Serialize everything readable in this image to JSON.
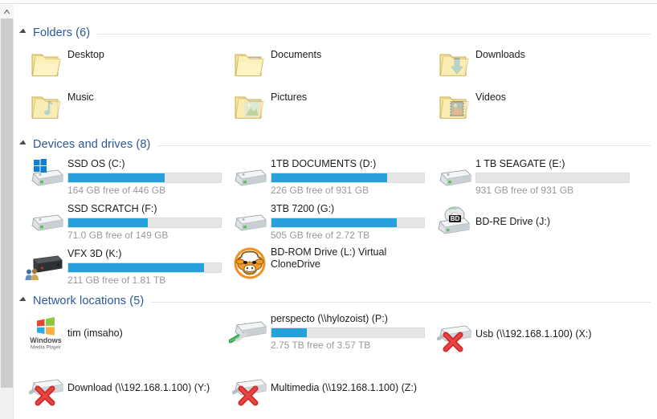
{
  "window": {
    "scrollbar": {
      "up_arrow": "scroll-up-arrow"
    }
  },
  "colors": {
    "group_header": "#2b5797",
    "bar_fill_blue": "#26a0da",
    "bar_track": "#e6e6e6",
    "label_text": "#1c1c1c",
    "sub_text": "#999999"
  },
  "groups": [
    {
      "id": "folders",
      "title": "Folders (6)",
      "expanded": true,
      "items": [
        {
          "name": "Desktop",
          "icon": "folder-desktop-icon"
        },
        {
          "name": "Documents",
          "icon": "folder-documents-icon"
        },
        {
          "name": "Downloads",
          "icon": "folder-downloads-icon"
        },
        {
          "name": "Music",
          "icon": "folder-music-icon"
        },
        {
          "name": "Pictures",
          "icon": "folder-pictures-icon"
        },
        {
          "name": "Videos",
          "icon": "folder-videos-icon"
        }
      ]
    },
    {
      "id": "devices",
      "title": "Devices and drives (8)",
      "expanded": true,
      "items": [
        {
          "name": "SSD OS (C:)",
          "icon": "hard-drive-windows-icon",
          "capacity": "164 GB free of 446 GB",
          "used_percent": 63,
          "bar": true
        },
        {
          "name": "1TB DOCUMENTS (D:)",
          "icon": "hard-drive-icon",
          "capacity": "226 GB free of 931 GB",
          "used_percent": 76,
          "bar": true
        },
        {
          "name": "1 TB SEAGATE (E:)",
          "icon": "hard-drive-icon",
          "capacity": "931 GB free of 931 GB",
          "used_percent": 0,
          "bar": true
        },
        {
          "name": "SSD SCRATCH (F:)",
          "icon": "hard-drive-icon",
          "capacity": "71.0 GB free of 149 GB",
          "used_percent": 52,
          "bar": true
        },
        {
          "name": "3TB 7200 (G:)",
          "icon": "hard-drive-icon",
          "capacity": "505 GB free of 2.72 TB",
          "used_percent": 82,
          "bar": true
        },
        {
          "name": "BD-RE Drive (J:)",
          "icon": "bd-re-drive-icon",
          "capacity": "",
          "used_percent": 0,
          "bar": false
        },
        {
          "name": "VFX 3D (K:)",
          "icon": "external-drive-shared-icon",
          "capacity": "211 GB free of 1.81 TB",
          "used_percent": 89,
          "bar": true
        },
        {
          "name": "BD-ROM Drive (L:) Virtual CloneDrive",
          "icon": "virtual-clonedrive-sheep-icon",
          "capacity": "",
          "used_percent": 0,
          "bar": false
        }
      ]
    },
    {
      "id": "network",
      "title": "Network locations (5)",
      "expanded": true,
      "items": [
        {
          "name": "tim (imsaho)",
          "icon": "windows-media-player-icon",
          "capacity": "",
          "used_percent": 0,
          "bar": false
        },
        {
          "name": "perspecto (\\\\hylozoist) (P:)",
          "icon": "network-drive-connected-icon",
          "capacity": "2.75 TB free of 3.57 TB",
          "used_percent": 23,
          "bar": true
        },
        {
          "name": "Usb (\\\\192.168.1.100) (X:)",
          "icon": "network-drive-disconnected-icon",
          "capacity": "",
          "used_percent": 0,
          "bar": false
        },
        {
          "name": "Download (\\\\192.168.1.100) (Y:)",
          "icon": "network-drive-disconnected-icon",
          "capacity": "",
          "used_percent": 0,
          "bar": false
        },
        {
          "name": "Multimedia (\\\\192.168.1.100) (Z:)",
          "icon": "network-drive-disconnected-icon",
          "capacity": "",
          "used_percent": 0,
          "bar": false
        }
      ]
    }
  ],
  "icon_text": {
    "bd_badge": "BD",
    "wmp_line1": "Windows",
    "wmp_line2": "Media Player"
  }
}
